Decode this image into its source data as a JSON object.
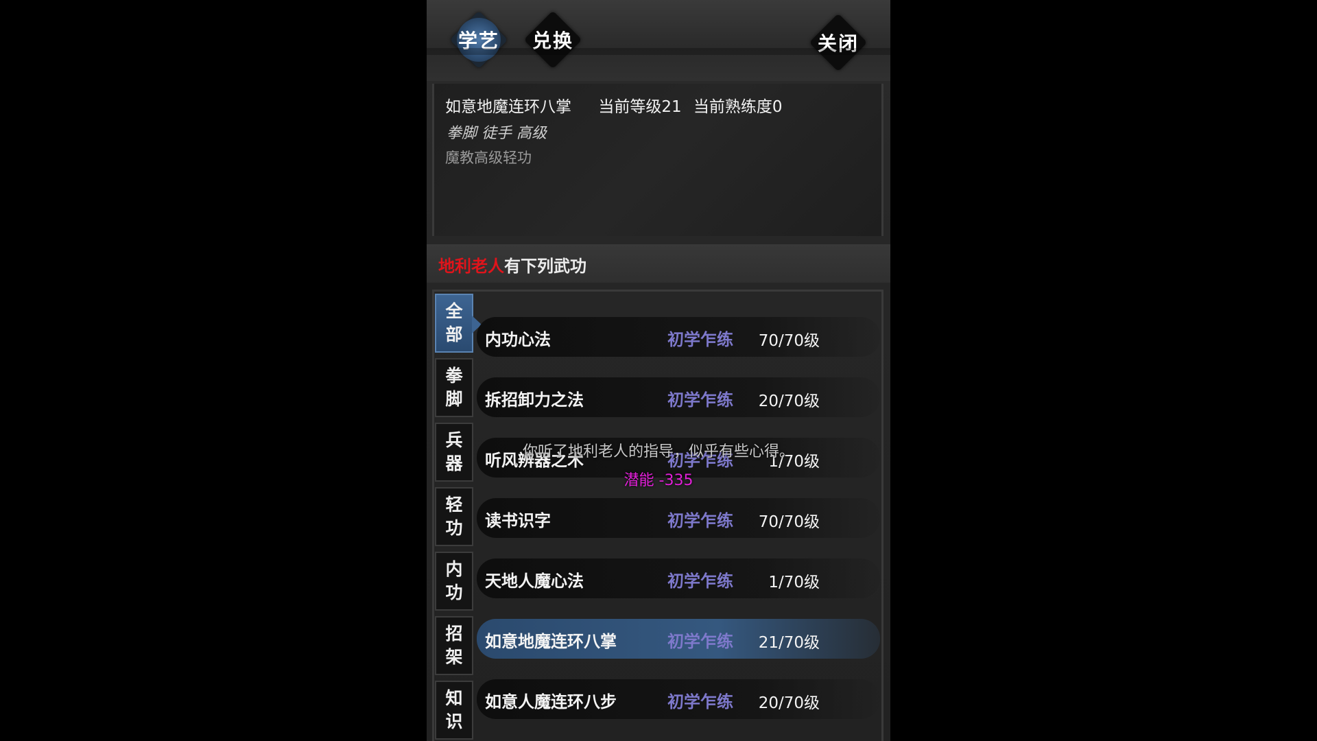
{
  "tabs": [
    {
      "label": "学艺",
      "active": true
    },
    {
      "label": "兑换",
      "active": false
    }
  ],
  "close_label": "关闭",
  "info": {
    "skill_name": "如意地魔连环八掌",
    "current_level": "当前等级21",
    "current_proficiency": "当前熟练度0",
    "tags": "拳脚 徒手 高级",
    "description": "魔教高级轻功"
  },
  "master": {
    "npc_name": "地利老人",
    "suffix": "有下列武功"
  },
  "categories": [
    {
      "line1": "全",
      "line2": "部",
      "active": true
    },
    {
      "line1": "拳",
      "line2": "脚",
      "active": false
    },
    {
      "line1": "兵",
      "line2": "器",
      "active": false
    },
    {
      "line1": "轻",
      "line2": "功",
      "active": false
    },
    {
      "line1": "内",
      "line2": "功",
      "active": false
    },
    {
      "line1": "招",
      "line2": "架",
      "active": false
    },
    {
      "line1": "知",
      "line2": "识",
      "active": false
    }
  ],
  "skills": [
    {
      "name": "内功心法",
      "stage": "初学乍练",
      "level": "70/70级"
    },
    {
      "name": "拆招卸力之法",
      "stage": "初学乍练",
      "level": "20/70级"
    },
    {
      "name": "听风辨器之术",
      "stage": "初学乍练",
      "level": "1/70级"
    },
    {
      "name": "读书识字",
      "stage": "初学乍练",
      "level": "70/70级"
    },
    {
      "name": "天地人魔心法",
      "stage": "初学乍练",
      "level": "1/70级"
    },
    {
      "name": "如意地魔连环八掌",
      "stage": "初学乍练",
      "level": "21/70级",
      "selected": true
    },
    {
      "name": "如意人魔连环八步",
      "stage": "初学乍练",
      "level": "20/70级"
    }
  ],
  "notice": "你听了地利老人的指导，似乎有些心得。",
  "potential": "潜能 -335"
}
